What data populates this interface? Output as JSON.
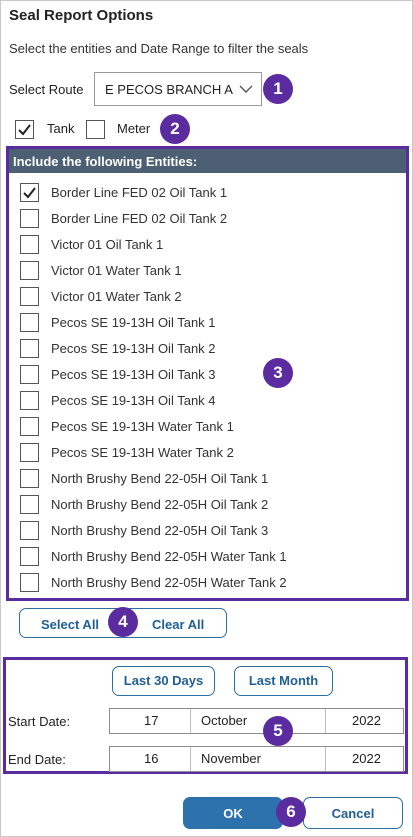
{
  "dialog": {
    "title": "Seal Report Options",
    "subtitle": "Select the entities and Date Range to filter the seals"
  },
  "route": {
    "label": "Select Route",
    "value": "E PECOS BRANCH A"
  },
  "filters": {
    "tank": {
      "label": "Tank",
      "checked": true
    },
    "meter": {
      "label": "Meter",
      "checked": false
    }
  },
  "entities": {
    "header": "Include the following Entities:",
    "items": [
      {
        "label": "Border Line FED 02 Oil Tank 1",
        "checked": true
      },
      {
        "label": "Border Line FED 02 Oil Tank 2",
        "checked": false
      },
      {
        "label": "Victor 01 Oil Tank 1",
        "checked": false
      },
      {
        "label": "Victor 01 Water Tank 1",
        "checked": false
      },
      {
        "label": "Victor 01 Water Tank 2",
        "checked": false
      },
      {
        "label": "Pecos SE 19-13H Oil Tank 1",
        "checked": false
      },
      {
        "label": "Pecos SE 19-13H Oil Tank 2",
        "checked": false
      },
      {
        "label": "Pecos SE 19-13H Oil Tank 3",
        "checked": false
      },
      {
        "label": "Pecos SE 19-13H Oil Tank 4",
        "checked": false
      },
      {
        "label": "Pecos SE 19-13H Water Tank 1",
        "checked": false
      },
      {
        "label": "Pecos SE 19-13H Water Tank 2",
        "checked": false
      },
      {
        "label": "North Brushy Bend 22-05H Oil Tank 1",
        "checked": false
      },
      {
        "label": "North Brushy Bend 22-05H Oil Tank 2",
        "checked": false
      },
      {
        "label": "North Brushy Bend 22-05H Oil Tank 3",
        "checked": false
      },
      {
        "label": "North Brushy Bend 22-05H Water Tank 1",
        "checked": false
      },
      {
        "label": "North Brushy Bend 22-05H Water Tank 2",
        "checked": false
      }
    ]
  },
  "selection_buttons": {
    "select_all": "Select All",
    "clear_all": "Clear All"
  },
  "date_range": {
    "last_30_days": "Last 30 Days",
    "last_month": "Last Month",
    "start": {
      "label": "Start Date:",
      "day": "17",
      "month": "October",
      "year": "2022"
    },
    "end": {
      "label": "End Date:",
      "day": "16",
      "month": "November",
      "year": "2022"
    }
  },
  "footer": {
    "ok": "OK",
    "cancel": "Cancel"
  },
  "callouts": [
    "1",
    "2",
    "3",
    "4",
    "5",
    "6"
  ],
  "colors": {
    "callout": "#5b2ca0",
    "header_bg": "#4d5f73",
    "primary": "#2d72ad"
  }
}
